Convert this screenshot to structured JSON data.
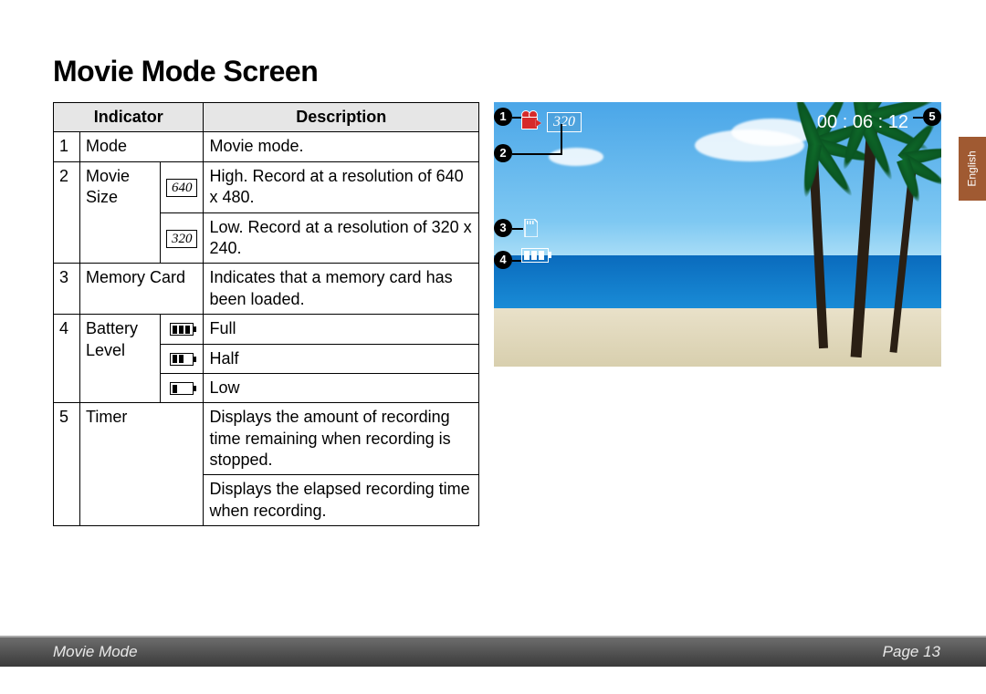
{
  "title": "Movie Mode Screen",
  "language_tab": "English",
  "footer": {
    "section": "Movie Mode",
    "page_label": "Page 13"
  },
  "table": {
    "headers": {
      "indicator": "Indicator",
      "description": "Description"
    },
    "rows": {
      "r1": {
        "num": "1",
        "indicator": "Mode",
        "description": "Movie mode."
      },
      "r2": {
        "num": "2",
        "indicator": "Movie Size",
        "opt_a": {
          "icon": "640",
          "description": "High. Record at a resolution of 640 x 480."
        },
        "opt_b": {
          "icon": "320",
          "description": "Low. Record at a resolution of 320 x 240."
        }
      },
      "r3": {
        "num": "3",
        "indicator": "Memory Card",
        "description": "Indicates that a memory card has been loaded."
      },
      "r4": {
        "num": "4",
        "indicator": "Battery Level",
        "opt_a": "Full",
        "opt_b": "Half",
        "opt_c": "Low"
      },
      "r5": {
        "num": "5",
        "indicator": "Timer",
        "desc_a": "Displays the amount of recording time remaining when recording is stopped.",
        "desc_b": "Displays the elapsed recording time when recording."
      }
    }
  },
  "preview_osd": {
    "size_label": "320",
    "timer": "00 : 06 : 12"
  },
  "callouts": {
    "c1": "1",
    "c2": "2",
    "c3": "3",
    "c4": "4",
    "c5": "5"
  }
}
